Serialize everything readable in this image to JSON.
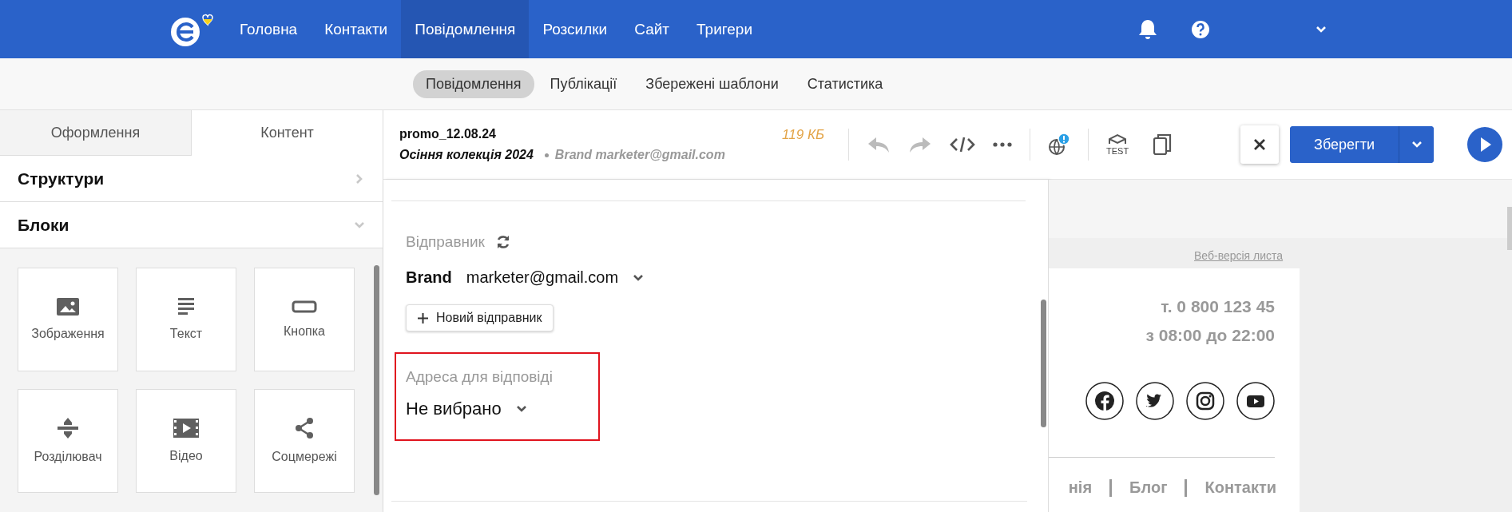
{
  "top_nav": {
    "items": [
      {
        "label": "Головна",
        "selected": false
      },
      {
        "label": "Контакти",
        "selected": false
      },
      {
        "label": "Повідомлення",
        "selected": true
      },
      {
        "label": "Розсилки",
        "selected": false
      },
      {
        "label": "Сайт",
        "selected": false
      },
      {
        "label": "Тригери",
        "selected": false
      }
    ]
  },
  "sub_nav": {
    "items": [
      {
        "label": "Повідомлення",
        "selected": true
      },
      {
        "label": "Публікації",
        "selected": false
      },
      {
        "label": "Збережені шаблони",
        "selected": false
      },
      {
        "label": "Статистика",
        "selected": false
      }
    ]
  },
  "sidebar": {
    "tabs": [
      {
        "label": "Оформлення",
        "selected": false
      },
      {
        "label": "Контент",
        "selected": true
      }
    ],
    "sections": [
      {
        "title": "Структури",
        "expanded": false
      },
      {
        "title": "Блоки",
        "expanded": true
      }
    ],
    "blocks": [
      {
        "label": "Зображення",
        "kind": "image"
      },
      {
        "label": "Текст",
        "kind": "text"
      },
      {
        "label": "Кнопка",
        "kind": "button"
      },
      {
        "label": "Розділювач",
        "kind": "divider"
      },
      {
        "label": "Відео",
        "kind": "video"
      },
      {
        "label": "Соцмережі",
        "kind": "social"
      }
    ]
  },
  "message": {
    "name": "promo_12.08.24",
    "subject": "Осіння колекція 2024",
    "sender": "Brand marketer@gmail.com",
    "size": "119 КБ"
  },
  "toolbar": {
    "test_label": "TEST",
    "save_button": "Зберегти"
  },
  "sender_panel": {
    "sender_label": "Відправник",
    "sender_name": "Brand",
    "sender_email": "marketer@gmail.com",
    "new_sender_button": "Новий відправник",
    "reply_to_label": "Адреса для відповіді",
    "reply_to_value": "Не вибрано"
  },
  "preview": {
    "web_version_link": "Веб-версія листа",
    "phone": "т. 0 800 123 45",
    "hours": "з 08:00 до 22:00",
    "social": [
      {
        "kind": "facebook"
      },
      {
        "kind": "twitter"
      },
      {
        "kind": "instagram"
      },
      {
        "kind": "youtube"
      }
    ],
    "footer_links": [
      "нія",
      "Блог",
      "Контакти"
    ]
  }
}
